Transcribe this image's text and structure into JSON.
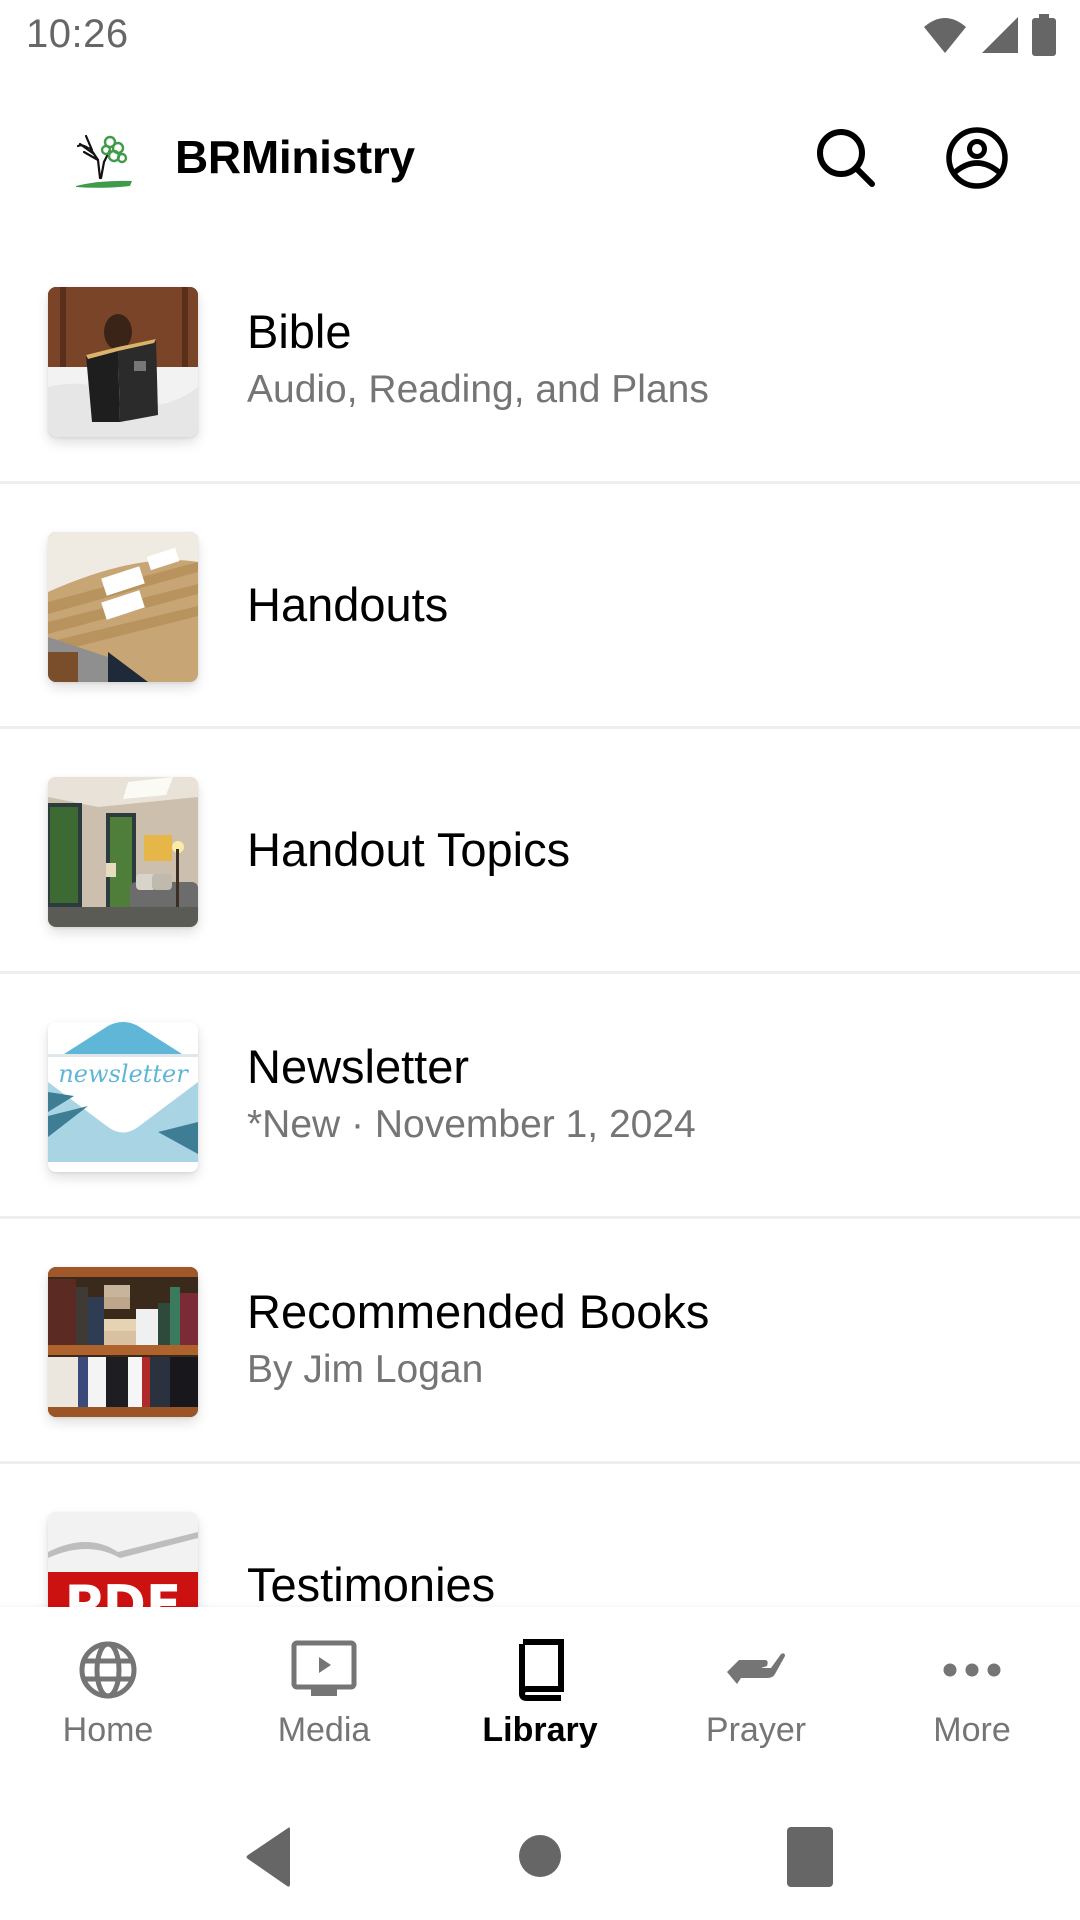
{
  "status_bar": {
    "time": "10:26",
    "icons": [
      "wifi-icon",
      "cellular-signal-icon",
      "battery-icon"
    ]
  },
  "app_bar": {
    "title": "BRMinistry",
    "logo": "tree-logo",
    "actions": [
      {
        "name": "search",
        "icon": "search-icon"
      },
      {
        "name": "profile",
        "icon": "account-circle-icon"
      }
    ]
  },
  "library": {
    "items": [
      {
        "title": "Bible",
        "subtitle": "Audio, Reading, and Plans",
        "thumbnail": "person reading bible"
      },
      {
        "title": "Handouts",
        "subtitle": "",
        "thumbnail": "file folders"
      },
      {
        "title": "Handout Topics",
        "subtitle": "",
        "thumbnail": "counseling room"
      },
      {
        "title": "Newsletter",
        "subtitle": "*New · November 1, 2024",
        "thumbnail": "newsletter envelope"
      },
      {
        "title": "Recommended Books",
        "subtitle": "By Jim Logan",
        "thumbnail": "bookshelf"
      },
      {
        "title": "Testimonies",
        "subtitle": "",
        "thumbnail": "PDF document"
      }
    ]
  },
  "bottom_nav": {
    "active": "Library",
    "items": [
      {
        "label": "Home",
        "icon": "globe-icon"
      },
      {
        "label": "Media",
        "icon": "tv-play-icon"
      },
      {
        "label": "Library",
        "icon": "book-icon"
      },
      {
        "label": "Prayer",
        "icon": "praying-hand-icon"
      },
      {
        "label": "More",
        "icon": "more-horizontal-icon"
      }
    ]
  },
  "system_nav": {
    "buttons": [
      "back",
      "home",
      "recents"
    ]
  },
  "colors": {
    "text_primary": "#000000",
    "text_secondary": "#757575",
    "divider": "#eeeeee",
    "icon_inactive": "#757575",
    "logo_green": "#3f9a4a"
  }
}
